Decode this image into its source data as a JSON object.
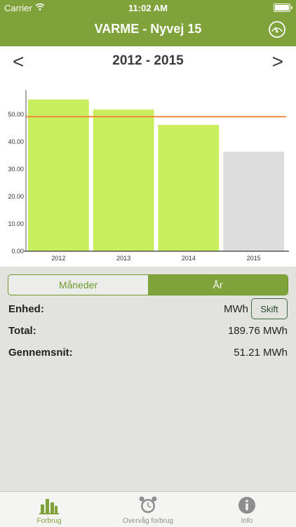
{
  "status_bar": {
    "carrier": "Carrier",
    "time": "11:02 AM"
  },
  "header": {
    "title": "VARME - Nyvej 15",
    "gauge_icon": "gauge-icon"
  },
  "navigation": {
    "prev": "<",
    "next": ">",
    "period": "2012 - 2015"
  },
  "chart_data": {
    "type": "bar",
    "categories": [
      "2012",
      "2013",
      "2014",
      "2015"
    ],
    "values": [
      55.5,
      51.8,
      46.2,
      36.4
    ],
    "bar_colors": [
      "#c9ee5d",
      "#c9ee5d",
      "#c9ee5d",
      "#dddddd"
    ],
    "average_line": 49.2,
    "average_color": "#f08a3a",
    "y_ticks": [
      "0.00",
      "10.00",
      "20.00",
      "30.00",
      "40.00",
      "50.00"
    ],
    "ylim": [
      0,
      58
    ]
  },
  "segment": {
    "months": "Måneder",
    "year": "År",
    "selected": "year"
  },
  "details": {
    "unit_label": "Enhed:",
    "unit_value": "MWh",
    "change_button": "Skift",
    "total_label": "Total:",
    "total_value": "189.76 MWh",
    "avg_label": "Gennemsnit:",
    "avg_value": "51.21 MWh"
  },
  "tabs": [
    {
      "label": "Forbrug",
      "icon": "bar-chart-icon",
      "active": true
    },
    {
      "label": "Overvåg forbrug",
      "icon": "alarm-clock-icon",
      "active": false
    },
    {
      "label": "Info",
      "icon": "info-icon",
      "active": false
    }
  ]
}
